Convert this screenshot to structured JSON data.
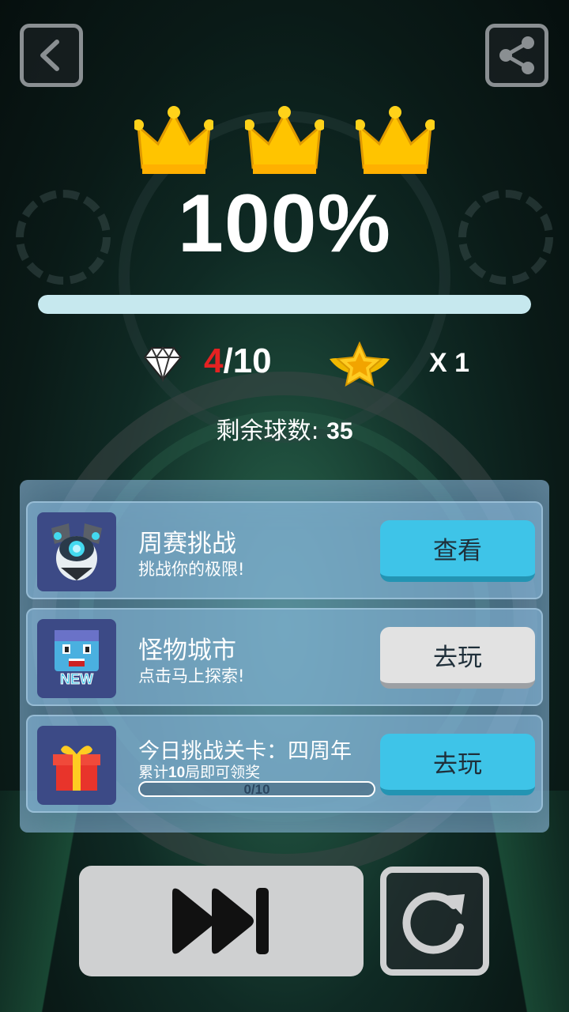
{
  "header": {
    "back_icon": "chevron-left-icon",
    "share_icon": "share-icon"
  },
  "result": {
    "crowns_earned": 3,
    "crowns_total": 3,
    "percent_text": "100%",
    "progress_fraction": 1.0
  },
  "stats": {
    "gems_current": "4",
    "gems_total": "/10",
    "gems_current_color": "#e52222",
    "star_multiplier": "X 1"
  },
  "balls": {
    "label": "剩余球数:",
    "value": "35"
  },
  "cards": [
    {
      "title": "周赛挑战",
      "subtitle": "挑战你的极限!",
      "button": "查看",
      "button_style": "blue",
      "icon": "robot-character-icon"
    },
    {
      "title": "怪物城市",
      "subtitle": "点击马上探索!",
      "button": "去玩",
      "button_style": "gray",
      "icon": "monster-new-icon",
      "badge": "NEW"
    },
    {
      "title": "今日挑战关卡：四周年",
      "subtitle_pre": "累计",
      "subtitle_num": "10",
      "subtitle_post": "局即可领奖",
      "button": "去玩",
      "button_style": "blue",
      "icon": "gift-box-icon",
      "progress_text": "0/10",
      "progress_fraction": 0
    }
  ],
  "controls": {
    "skip_icon": "fast-forward-icon",
    "restart_icon": "restart-icon"
  },
  "colors": {
    "accent_blue": "#3ec4e8",
    "crown_gold": "#ffc400",
    "progress_fill": "#c6e8ee"
  }
}
